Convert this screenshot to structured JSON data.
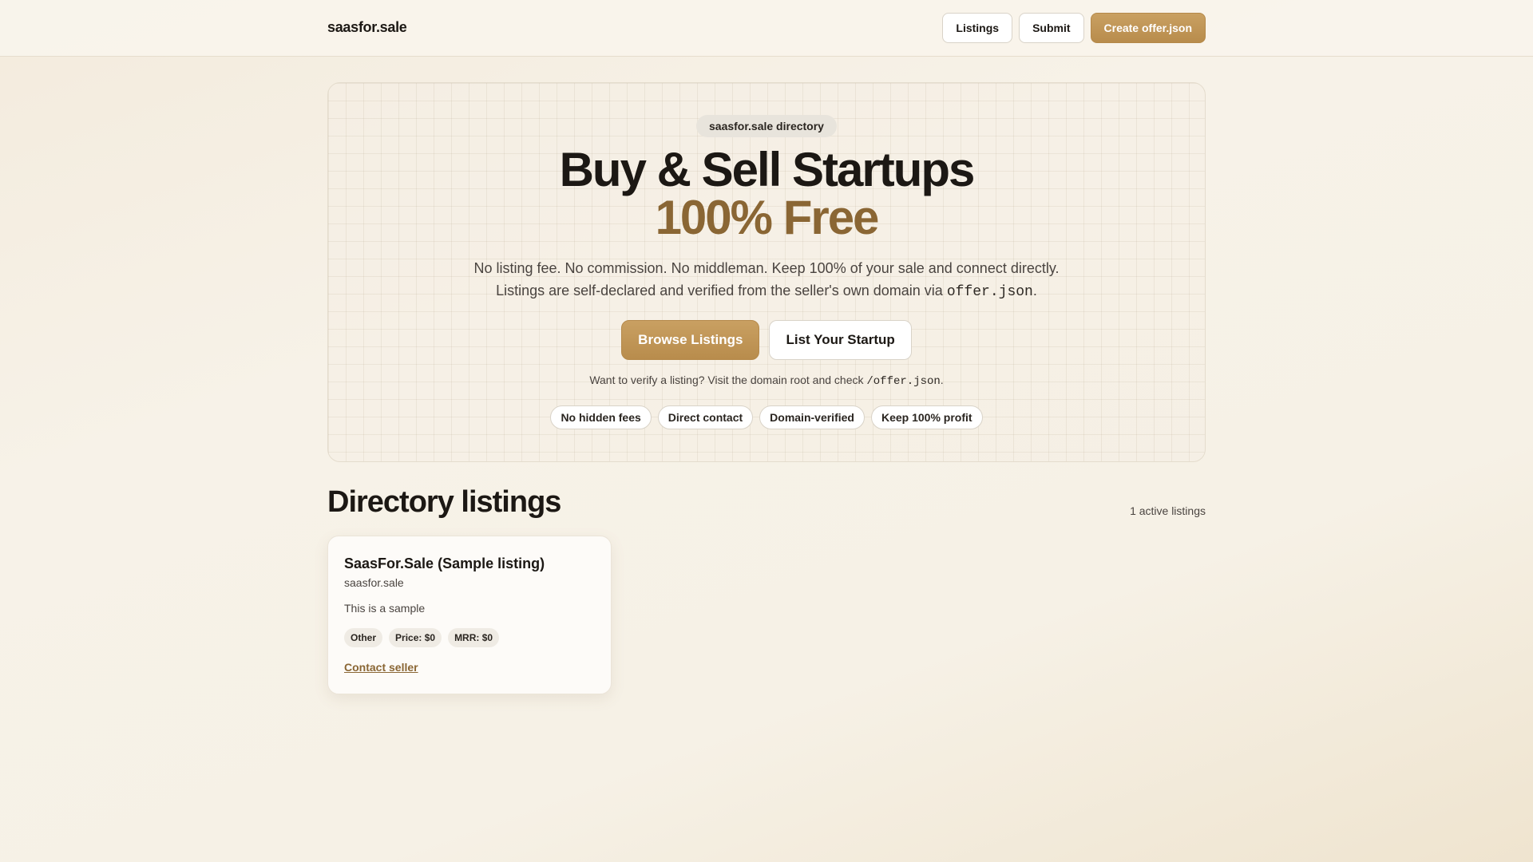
{
  "header": {
    "brand": "saasfor.sale",
    "nav": {
      "listings_label": "Listings",
      "submit_label": "Submit",
      "create_label": "Create offer.json"
    }
  },
  "hero": {
    "badge": "saasfor.sale directory",
    "title": "Buy & Sell Startups",
    "title_accent": "100% Free",
    "subtitle_line1": "No listing fee. No commission. No middleman. Keep 100% of your sale and connect directly.",
    "subtitle_line2_prefix": "Listings are self-declared and verified from the seller's own domain via",
    "subtitle_line2_code": "offer.json",
    "subtitle_line2_suffix": ".",
    "browse_label": "Browse Listings",
    "list_label": "List Your Startup",
    "verify_prefix": "Want to verify a listing? Visit the domain root and check",
    "verify_code": "/offer.json",
    "verify_suffix": ".",
    "features": [
      "No hidden fees",
      "Direct contact",
      "Domain-verified",
      "Keep 100% profit"
    ]
  },
  "directory": {
    "title": "Directory listings",
    "count_text": "1 active listings",
    "listings": [
      {
        "title": "SaasFor.Sale (Sample listing)",
        "domain": "saasfor.sale",
        "description": "This is a sample",
        "tags": [
          "Other",
          "Price: $0",
          "MRR: $0"
        ],
        "contact_label": "Contact seller"
      }
    ]
  },
  "colors": {
    "accent_gold": "#b88c4c",
    "accent_text": "#8a6634",
    "background": "#f6f1e6"
  }
}
